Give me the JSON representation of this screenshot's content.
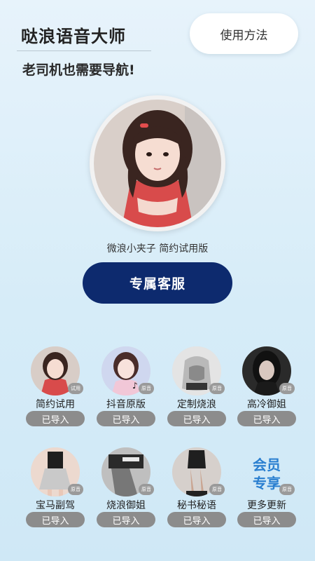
{
  "header": {
    "title": "哒浪语音大师",
    "subtitle": "老司机也需要导航!",
    "usage_button": "使用方法"
  },
  "current_voice": {
    "caption": "微浪小夹子 简约试用版",
    "service_button": "专属客服"
  },
  "voices": [
    {
      "name": "简约试用",
      "badge": "试用",
      "button": "已导入"
    },
    {
      "name": "抖音原版",
      "badge": "原音",
      "button": "已导入"
    },
    {
      "name": "定制烧浪",
      "badge": "原音",
      "button": "已导入"
    },
    {
      "name": "高冷御姐",
      "badge": "原音",
      "button": "已导入"
    },
    {
      "name": "宝马副驾",
      "badge": "原音",
      "button": "已导入"
    },
    {
      "name": "烧浪御姐",
      "badge": "原音",
      "button": "已导入"
    },
    {
      "name": "秘书秘语",
      "badge": "原音",
      "button": "已导入"
    },
    {
      "name": "更多更新",
      "badge": "原音",
      "button": "已导入",
      "logo_text": "会员专享"
    }
  ]
}
